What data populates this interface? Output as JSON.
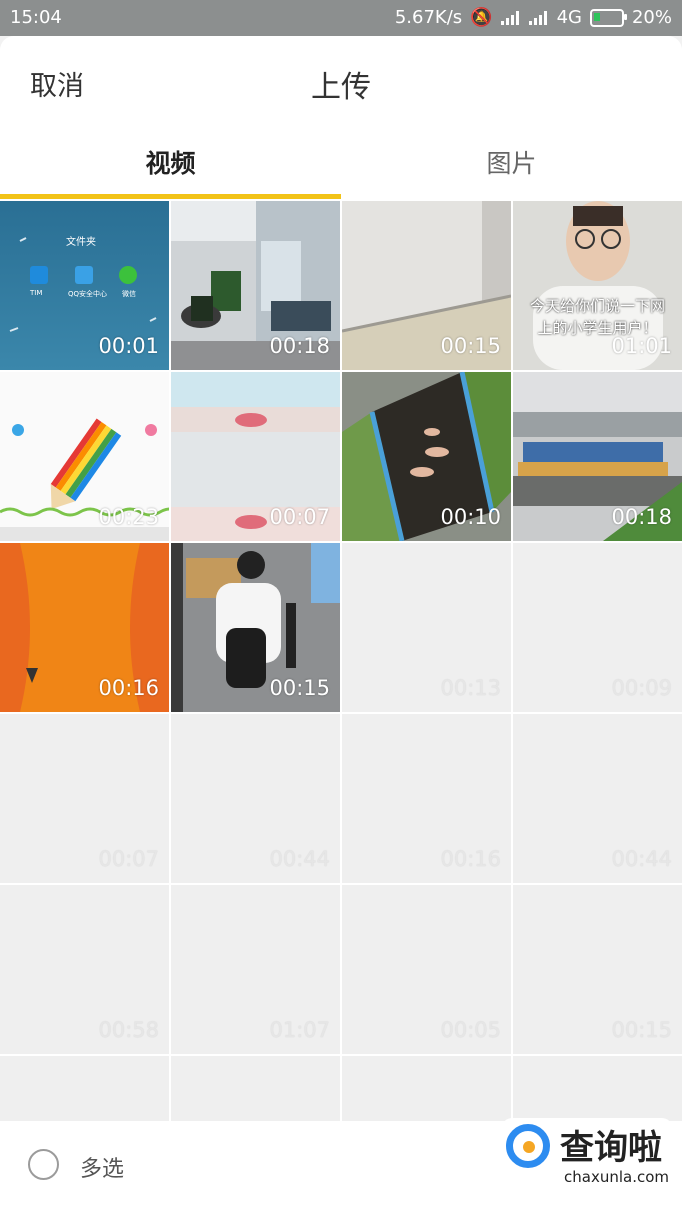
{
  "status_bar": {
    "time": "15:04",
    "speed": "5.67K/s",
    "network": "4G",
    "battery": "20%"
  },
  "header": {
    "cancel_label": "取消",
    "title": "上传"
  },
  "tabs": [
    {
      "label": "视频",
      "active": true
    },
    {
      "label": "图片",
      "active": false
    }
  ],
  "accent_color": "#f2c318",
  "videos": [
    {
      "duration": "00:01",
      "thumb": "phone-homescreen"
    },
    {
      "duration": "00:18",
      "thumb": "office-waiting-room"
    },
    {
      "duration": "00:15",
      "thumb": "white-wall-room"
    },
    {
      "duration": "01:01",
      "thumb": "boy-with-glasses"
    },
    {
      "duration": "00:23",
      "thumb": "rainbow-pencil"
    },
    {
      "duration": "00:07",
      "thumb": "lips-closeup"
    },
    {
      "duration": "00:10",
      "thumb": "canal-swimmers"
    },
    {
      "duration": "00:18",
      "thumb": "riverside-market"
    },
    {
      "duration": "00:16",
      "thumb": "orange-pattern"
    },
    {
      "duration": "00:15",
      "thumb": "boy-sitting-street"
    },
    {
      "duration": "00:13",
      "thumb": "empty"
    },
    {
      "duration": "00:09",
      "thumb": "empty"
    },
    {
      "duration": "00:07",
      "thumb": "empty"
    },
    {
      "duration": "00:44",
      "thumb": "empty"
    },
    {
      "duration": "00:16",
      "thumb": "empty"
    },
    {
      "duration": "00:44",
      "thumb": "empty"
    },
    {
      "duration": "00:58",
      "thumb": "empty"
    },
    {
      "duration": "01:07",
      "thumb": "empty"
    },
    {
      "duration": "00:05",
      "thumb": "empty"
    },
    {
      "duration": "00:15",
      "thumb": "empty"
    },
    {
      "duration": "",
      "thumb": "empty"
    },
    {
      "duration": "",
      "thumb": "empty"
    },
    {
      "duration": "",
      "thumb": "empty"
    },
    {
      "duration": "",
      "thumb": "empty"
    }
  ],
  "thumb_texts": {
    "phone_folder": "文件夹",
    "app1": "TIM",
    "app2": "QQ安全中心",
    "app3": "微信",
    "overlay_line1": "今天给你们说一下网",
    "overlay_line2": "上的小学生用户！"
  },
  "footer": {
    "multi_select_label": "多选"
  },
  "watermark": {
    "cn": "查询啦",
    "en": "chaxunla.com"
  }
}
